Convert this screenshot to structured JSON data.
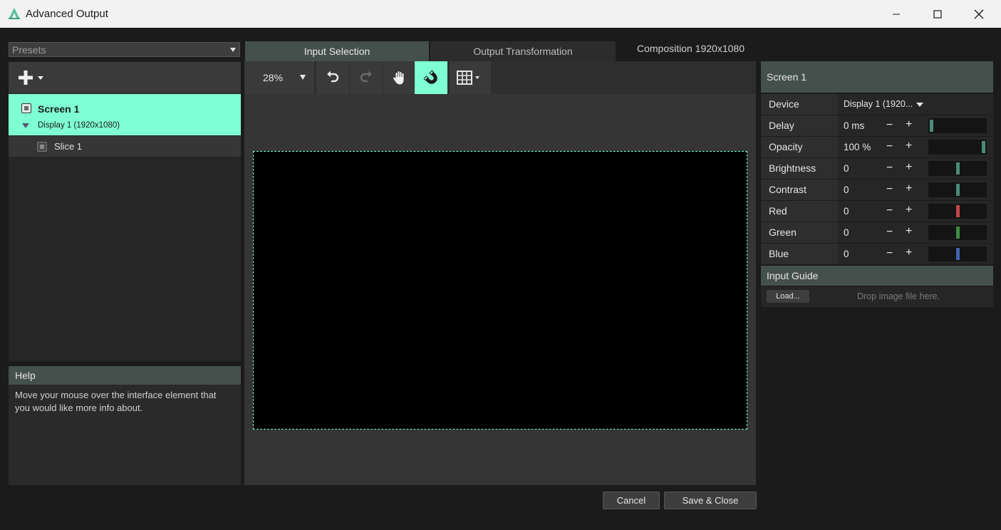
{
  "window": {
    "title": "Advanced Output",
    "minimize_icon": "minimize-icon",
    "maximize_icon": "maximize-icon",
    "close_icon": "close-icon"
  },
  "presets": {
    "value": "Presets"
  },
  "tree": {
    "screen": {
      "name": "Screen 1",
      "display": "Display 1 (1920x1080)"
    },
    "slice": {
      "name": "Slice 1"
    }
  },
  "help": {
    "title": "Help",
    "text": "Move your mouse over the interface element that you would like more info about."
  },
  "tabs": [
    {
      "label": "Input Selection",
      "active": true
    },
    {
      "label": "Output Transformation",
      "active": false
    }
  ],
  "composition_label": "Composition 1920x1080",
  "toolbar": {
    "zoom": "28%",
    "icons": [
      "undo-icon",
      "redo-icon",
      "hand-pan-icon",
      "magnet-snap-icon",
      "grid-icon"
    ]
  },
  "buttons": {
    "cancel": "Cancel",
    "save_close": "Save & Close"
  },
  "properties": {
    "title": "Screen 1",
    "device": {
      "label": "Device",
      "value": "Display 1 (1920..."
    },
    "rows": [
      {
        "label": "Delay",
        "value": "0 ms",
        "level": 0.0,
        "color": "#4a8a78"
      },
      {
        "label": "Opacity",
        "value": "100 %",
        "level": 1.0,
        "color": "#4a8a78"
      },
      {
        "label": "Brightness",
        "value": "0",
        "level": 0.5,
        "color": "#4a8a78"
      },
      {
        "label": "Contrast",
        "value": "0",
        "level": 0.5,
        "color": "#4a8a78"
      },
      {
        "label": "Red",
        "value": "0",
        "level": 0.5,
        "color": "#c0474a"
      },
      {
        "label": "Green",
        "value": "0",
        "level": 0.5,
        "color": "#3f8a3f"
      },
      {
        "label": "Blue",
        "value": "0",
        "level": 0.5,
        "color": "#3f64b0"
      }
    ],
    "minus": "−",
    "plus": "+"
  },
  "input_guide": {
    "title": "Input Guide",
    "load_label": "Load...",
    "drop_hint": "Drop image file here."
  },
  "colors": {
    "accent": "#7fffd4",
    "panel_header": "#44504c"
  }
}
